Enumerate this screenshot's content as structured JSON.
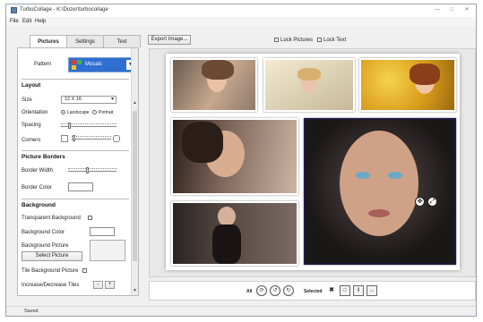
{
  "window": {
    "title": "TurboCollage - K:\\Dozer\\turbocollage"
  },
  "menu": {
    "items": [
      "File",
      "Edit",
      "Help"
    ]
  },
  "tabs": [
    "Pictures",
    "Settings",
    "Text"
  ],
  "pattern": {
    "label": "Pattern",
    "value": "Mosaic"
  },
  "layout": {
    "heading": "Layout",
    "size_label": "Size",
    "size_value": "12 X 16",
    "orientation_label": "Orientation",
    "landscape": "Landscape",
    "portrait": "Portrait",
    "spacing_label": "Spacing",
    "corners_label": "Corners"
  },
  "borders": {
    "heading": "Picture Borders",
    "width_label": "Border Width",
    "color_label": "Border Color",
    "color": "#ffffff"
  },
  "background": {
    "heading": "Background",
    "transparent_label": "Transparent Background",
    "color_label": "Background Color",
    "color": "#ffffff",
    "picture_label": "Background Picture",
    "select_button": "Select Picture",
    "tile_label": "Tile Background Picture",
    "incdec_label": "Increase/Decrease Tiles",
    "minus": "-",
    "plus": "+"
  },
  "toolbar": {
    "export": "Export Image...",
    "lock_pictures": "Lock Pictures",
    "lock_text": "Lock Text"
  },
  "bottom": {
    "all_label": "All",
    "selected_label": "Selected"
  },
  "status": "Saved",
  "colors": {
    "accent": "#2f6fd0",
    "selection": "#1a1a40"
  }
}
